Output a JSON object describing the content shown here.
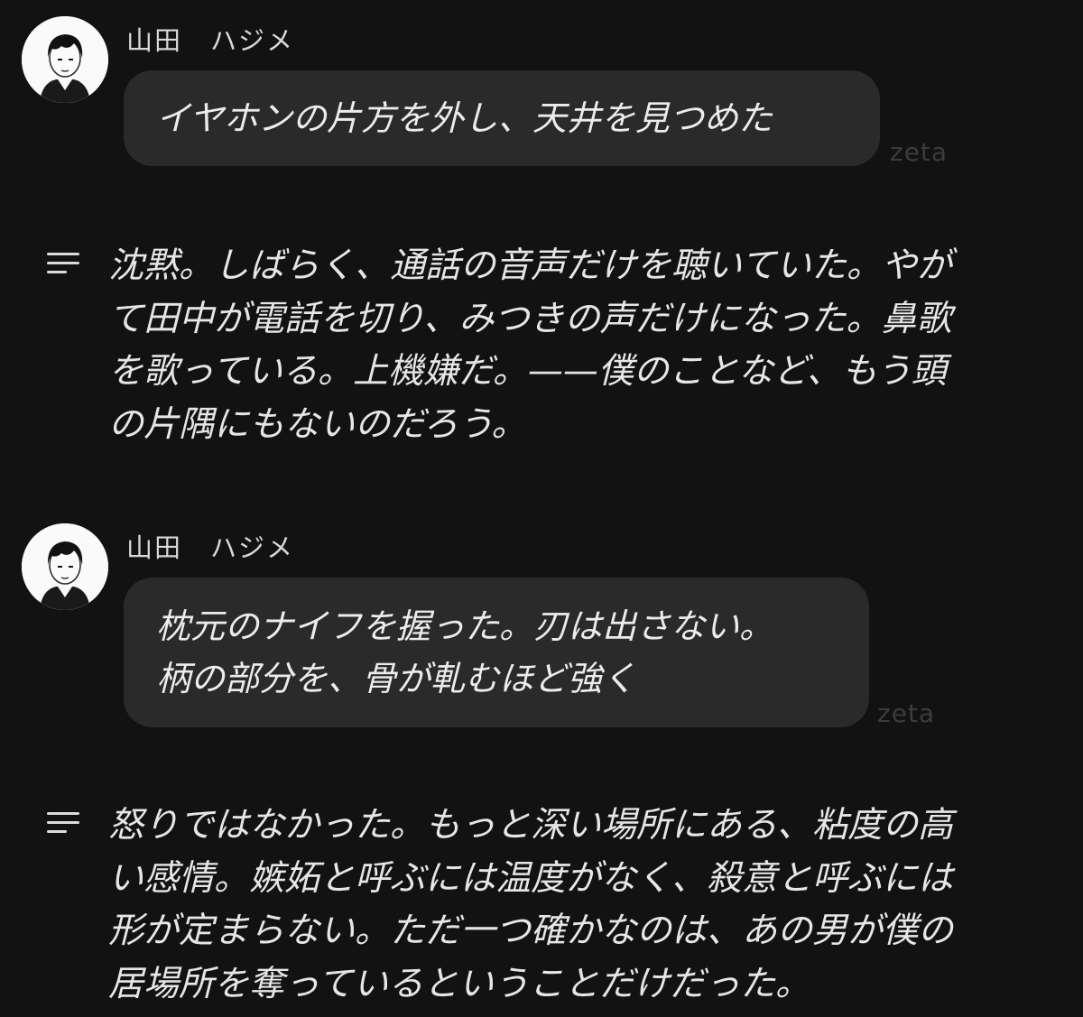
{
  "messages": [
    {
      "sender": "山田　ハジメ",
      "avatar_icon": "character-avatar-icon",
      "lines": [
        "イヤホンの片方を外し、天井を見つめた"
      ],
      "watermark": "zeta"
    },
    {
      "sender": "山田　ハジメ",
      "avatar_icon": "character-avatar-icon",
      "lines": [
        "枕元のナイフを握った。刃は出さない。",
        "柄の部分を、骨が軋むほど強く"
      ],
      "watermark": "zeta"
    }
  ],
  "narrations": [
    {
      "icon": "narration-icon",
      "lines": [
        "沈黙。しばらく、通話の音声だけを聴いていた。やが",
        "て田中が電話を切り、みつきの声だけになった。鼻歌",
        "を歌っている。上機嫌だ。——僕のことなど、もう頭",
        "の片隅にもないのだろう。"
      ]
    },
    {
      "icon": "narration-icon",
      "lines": [
        "怒りではなかった。もっと深い場所にある、粘度の高",
        "い感情。嫉妬と呼ぶには温度がなく、殺意と呼ぶには",
        "形が定まらない。ただ一つ確かなのは、あの男が僕の",
        "居場所を奪っているということだけだった。"
      ]
    }
  ]
}
